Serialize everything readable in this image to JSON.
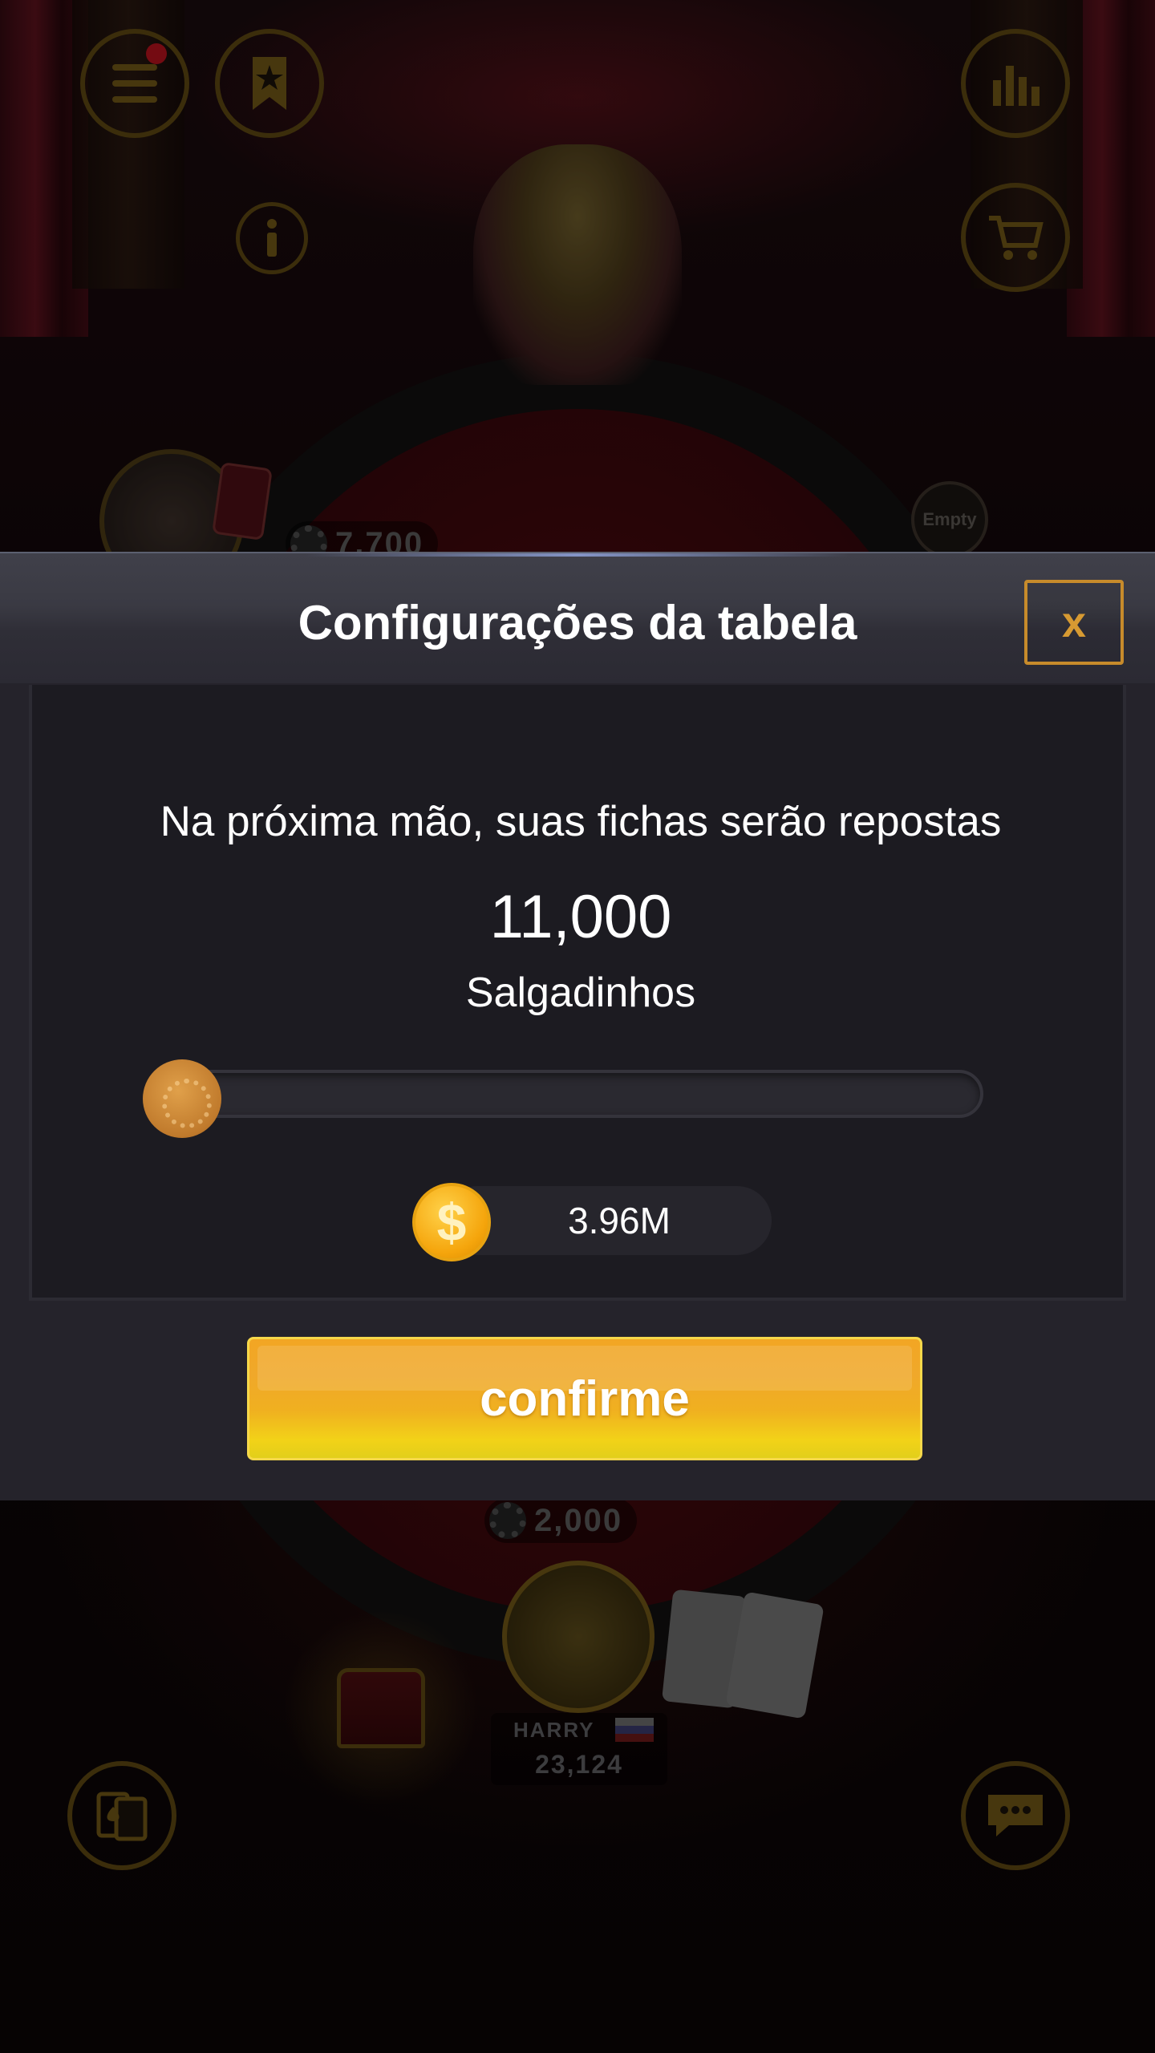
{
  "background": {
    "top_left_icons": [
      "menu-icon",
      "bookmark-star-icon",
      "info-icon"
    ],
    "top_right_icons": [
      "stats-icon",
      "cart-icon"
    ],
    "bottom_left_icon": "cards-icon",
    "bottom_right_icon": "chat-icon",
    "empty_seat_label": "Empty",
    "left_player_chips": "7,700",
    "pot_chips": "2,000",
    "player": {
      "name": "HARRY",
      "chips": "23,124"
    }
  },
  "dialog": {
    "title": "Configurações da tabela",
    "close_label": "x",
    "message": "Na próxima mão, suas fichas serão repostas",
    "chip_value": "11,000",
    "chip_unit": "Salgadinhos",
    "slider_level": 0,
    "balance": "3.96M",
    "coin_symbol": "$",
    "confirm_label": "confirme"
  },
  "colors": {
    "accent_gold": "#d79a32",
    "confirm_yellow": "#f2d218",
    "panel_dark": "#1c1b21"
  }
}
